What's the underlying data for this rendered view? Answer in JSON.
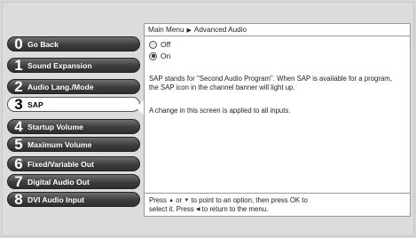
{
  "menu": {
    "items": [
      {
        "num": "0",
        "label": "Go Back"
      },
      {
        "num": "1",
        "label": "Sound Expansion"
      },
      {
        "num": "2",
        "label": "Audio Lang./Mode"
      },
      {
        "num": "3",
        "label": "SAP"
      },
      {
        "num": "4",
        "label": "Startup Volume"
      },
      {
        "num": "5",
        "label": "Maximum Volume"
      },
      {
        "num": "6",
        "label": "Fixed/Variable Out"
      },
      {
        "num": "7",
        "label": "Digital Audio Out"
      },
      {
        "num": "8",
        "label": "DVI Audio Input"
      }
    ],
    "selected_index": 3
  },
  "panel": {
    "breadcrumb_root": "Main Menu",
    "breadcrumb_current": "Advanced Audio",
    "options": [
      {
        "label": "Off",
        "selected": false
      },
      {
        "label": "On",
        "selected": true
      }
    ],
    "description1": "SAP stands for \"Second Audio Program\".  When SAP is available for a program, the SAP icon in the channel banner will light up.",
    "description2": "A change in this screen is applied to all inputs.",
    "footer_line1_a": "Press",
    "footer_line1_b": "or",
    "footer_line1_c": "to point to an option, then press OK to",
    "footer_line2_a": "select it. Press",
    "footer_line2_b": "to return to the menu."
  }
}
